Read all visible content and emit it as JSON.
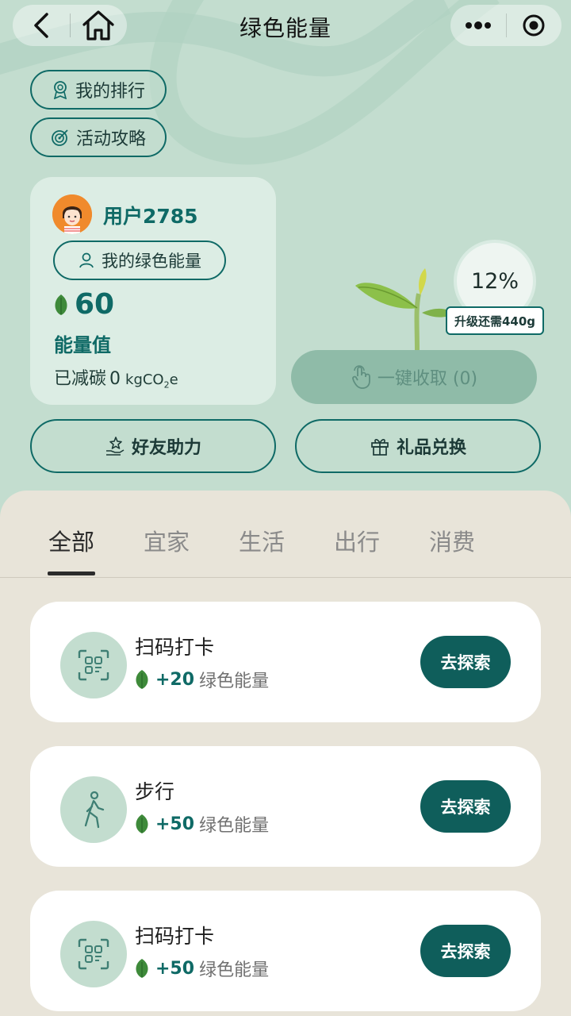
{
  "nav": {
    "title": "绿色能量",
    "back_icon": "chevron-left-icon",
    "home_icon": "home-icon",
    "more_icon": "more-icon",
    "record_icon": "target-icon"
  },
  "quick_links": [
    {
      "label": "我的排行",
      "icon": "ribbon-icon"
    },
    {
      "label": "活动攻略",
      "icon": "target-icon"
    }
  ],
  "user": {
    "name": "用户2785",
    "energy_button": "我的绿色能量",
    "energy_value": "60",
    "energy_label": "能量值",
    "carbon_prefix": "已减碳",
    "carbon_value": "0",
    "carbon_unit": "kgCO",
    "carbon_sub": "2",
    "carbon_suffix": "e"
  },
  "progress": {
    "percent_text": "12%",
    "percent_value": 0.12,
    "upgrade_text": "升级还需440g"
  },
  "collect_button": "一键收取 (0)",
  "actions": {
    "friends": "好友助力",
    "gifts": "礼品兑换"
  },
  "tabs": [
    "全部",
    "宜家",
    "生活",
    "出行",
    "消费"
  ],
  "active_tab": "全部",
  "tasks": [
    {
      "title": "扫码打卡",
      "points": "+20",
      "reward_label": "绿色能量",
      "button": "去探索",
      "icon": "scan-icon"
    },
    {
      "title": "步行",
      "points": "+50",
      "reward_label": "绿色能量",
      "button": "去探索",
      "icon": "walking-icon"
    },
    {
      "title": "扫码打卡",
      "points": "+50",
      "reward_label": "绿色能量",
      "button": "去探索",
      "icon": "scan-icon"
    }
  ],
  "colors": {
    "background": "#c3ddcf",
    "accent": "#0f6a66",
    "button_dark": "#0f5e5b",
    "sheet": "#e8e4d9"
  }
}
